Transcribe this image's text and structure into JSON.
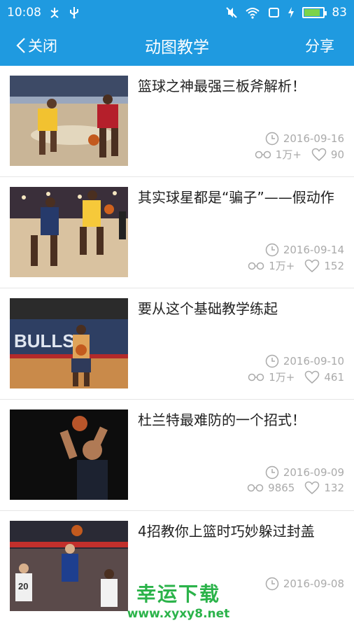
{
  "status_bar": {
    "time": "10:08",
    "battery": "83"
  },
  "nav": {
    "back_label": "关闭",
    "title": "动图教学",
    "share_label": "分享"
  },
  "articles": [
    {
      "title": "篮球之神最强三板斧解析！",
      "date": "2016-09-16",
      "views": "1万+",
      "likes": "90"
    },
    {
      "title": "其实球星都是“骗子”——假动作",
      "date": "2016-09-14",
      "views": "1万+",
      "likes": "152"
    },
    {
      "title": "要从这个基础教学练起",
      "date": "2016-09-10",
      "views": "1万+",
      "likes": "461"
    },
    {
      "title": "杜兰特最难防的一个招式！",
      "date": "2016-09-09",
      "views": "9865",
      "likes": "132"
    },
    {
      "title": "4招教你上篮时巧妙躲过封盖",
      "date": "2016-09-08"
    }
  ],
  "watermark": {
    "name": "幸运下载",
    "url": "www.xyxy8.net"
  },
  "colors": {
    "accent": "#1f9ae0",
    "watermark": "#2bb34a",
    "meta": "#aaaaaa"
  }
}
